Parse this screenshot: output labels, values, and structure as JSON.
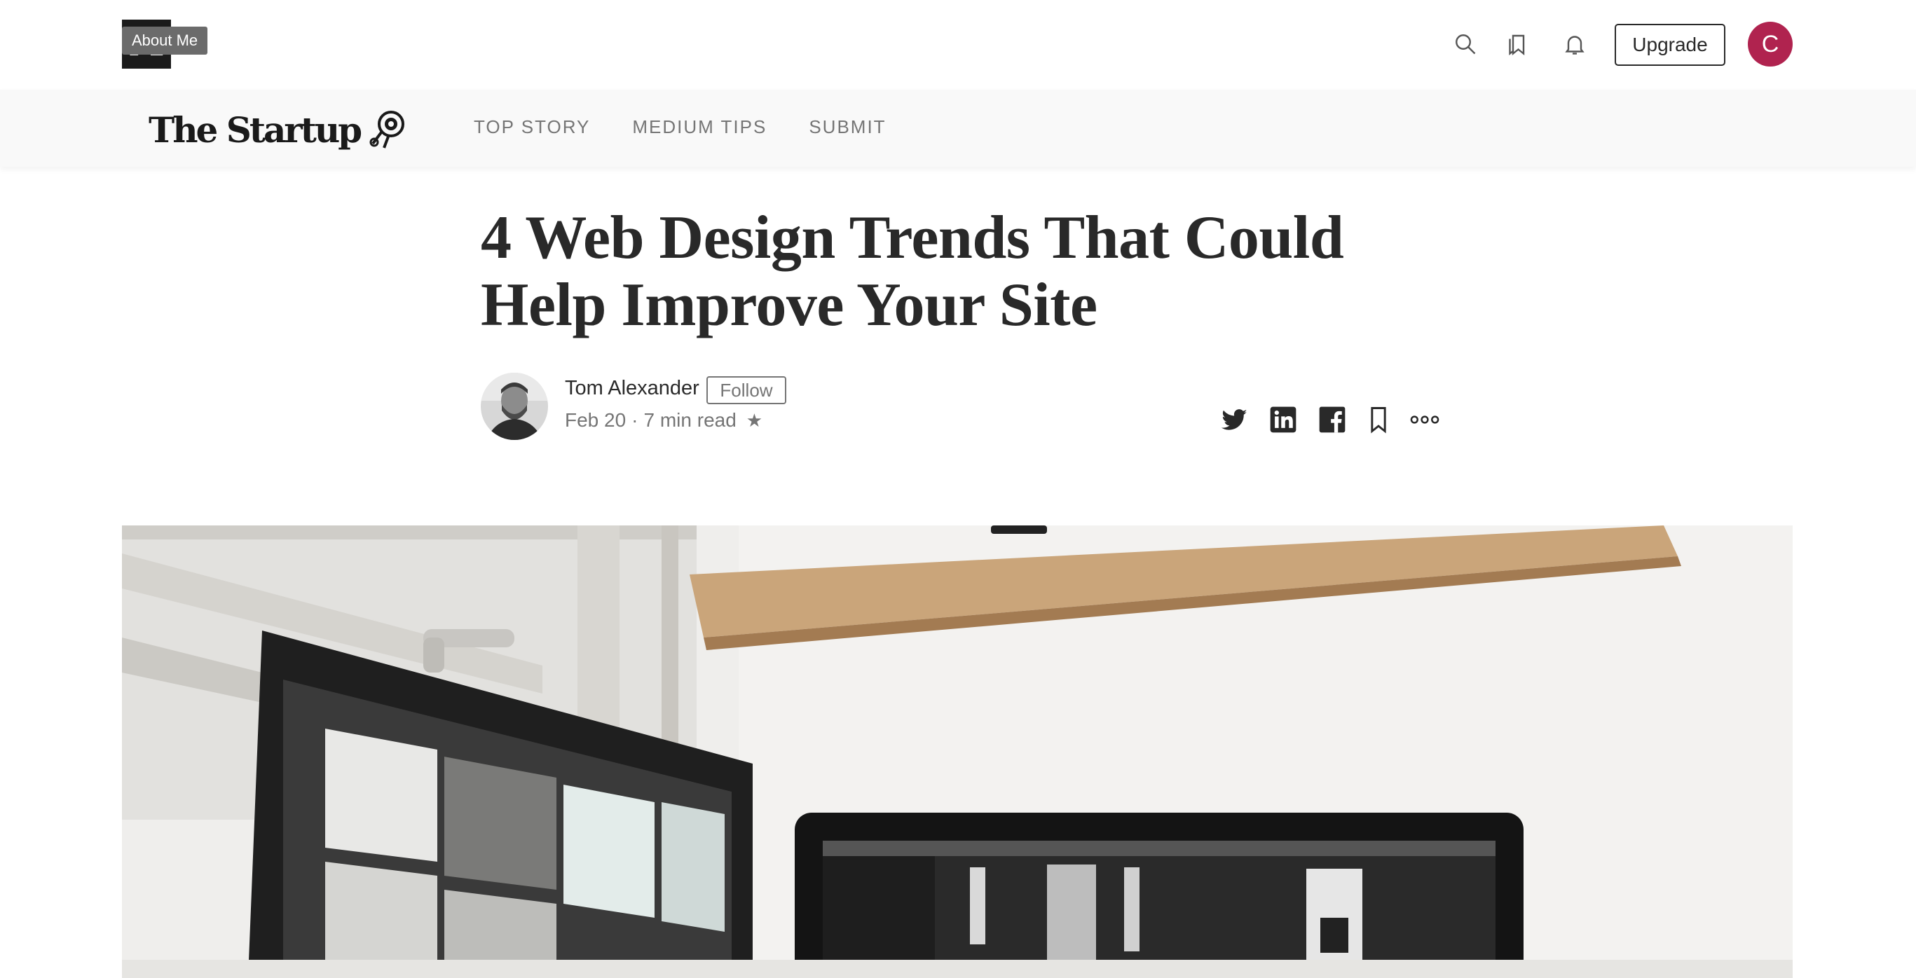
{
  "topbar": {
    "logo_letter": "M",
    "tooltip": "About Me",
    "upgrade_label": "Upgrade",
    "avatar_initial": "C",
    "icons": [
      "search-icon",
      "bookmarks-icon",
      "bell-icon"
    ]
  },
  "publication": {
    "name": "The Startup",
    "nav": [
      {
        "label": "TOP STORY"
      },
      {
        "label": "MEDIUM TIPS"
      },
      {
        "label": "SUBMIT"
      }
    ]
  },
  "article": {
    "title": "4 Web Design Trends That Could Help Improve Your Site",
    "author": "Tom Alexander",
    "follow_label": "Follow",
    "date": "Feb 20",
    "separator": "·",
    "read_time": "7 min read",
    "star": "★"
  },
  "share": {
    "icons": [
      "twitter-icon",
      "linkedin-icon",
      "facebook-icon",
      "bookmark-icon",
      "more-options-icon"
    ]
  },
  "colors": {
    "accent_avatar": "#b0234f",
    "text_primary": "#292929",
    "text_secondary": "#757575",
    "pubbar_bg": "#f9f9f9"
  }
}
